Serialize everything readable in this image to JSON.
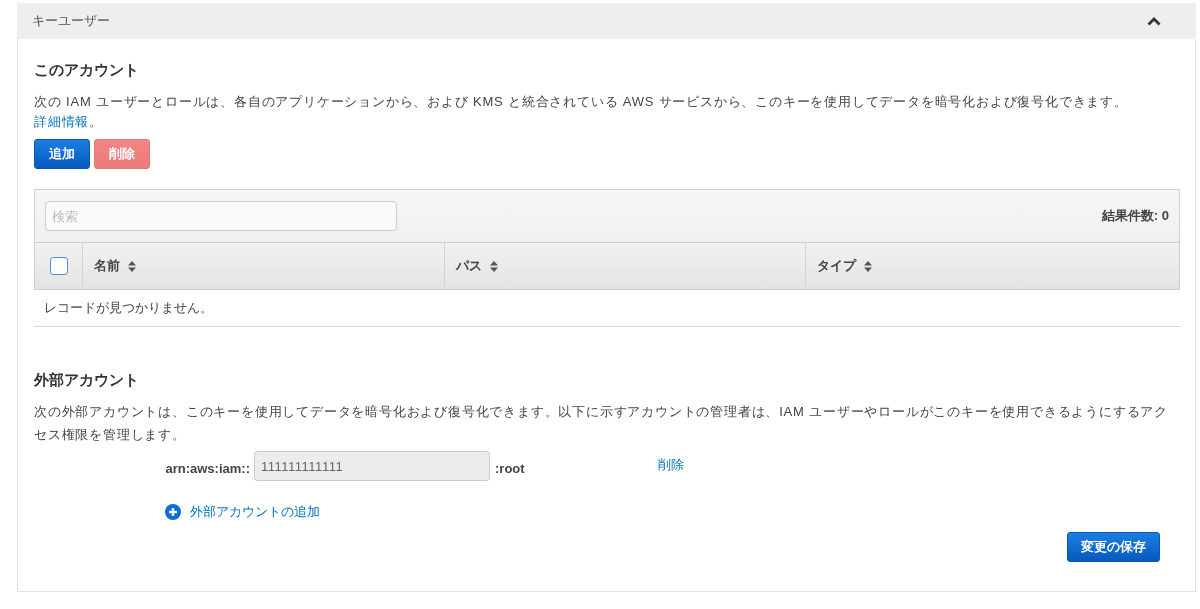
{
  "panel": {
    "title": "キーユーザー",
    "expanded": true
  },
  "this_account": {
    "heading": "このアカウント",
    "description": "次の IAM ユーザーとロールは、各自のアプリケーションから、および KMS と統合されている AWS サービスから、このキーを使用してデータを暗号化および復号化できます。",
    "link": "詳細情報",
    "description_end": "。",
    "buttons": [
      {
        "label": "追加",
        "kind": "primary",
        "disabled": false
      },
      {
        "label": "削除",
        "kind": "danger",
        "disabled": true
      }
    ],
    "table": {
      "search": {
        "placeholder": "検索"
      },
      "result_count": "結果件数: 0",
      "select_all": {
        "checked": false
      },
      "columns": [
        {
          "label": "名前"
        },
        {
          "label": "パス"
        },
        {
          "label": "タイプ"
        }
      ],
      "empty_message": "レコードが見つかりません。"
    }
  },
  "external_accounts": {
    "heading": "外部アカウント",
    "description": "次の外部アカウントは、このキーを使用してデータを暗号化および復号化できます。以下に示すアカウントの管理者は、IAM ユーザーやロールがこのキーを使用できるようにするアクセス権限を管理します。",
    "accounts": [
      {
        "prefix": "arn:aws:iam::",
        "value": "111111111111",
        "suffix": ":root",
        "remove": "削除",
        "disabled": true
      }
    ],
    "add_link": "外部アカウントの追加"
  },
  "save_button": "変更の保存"
}
